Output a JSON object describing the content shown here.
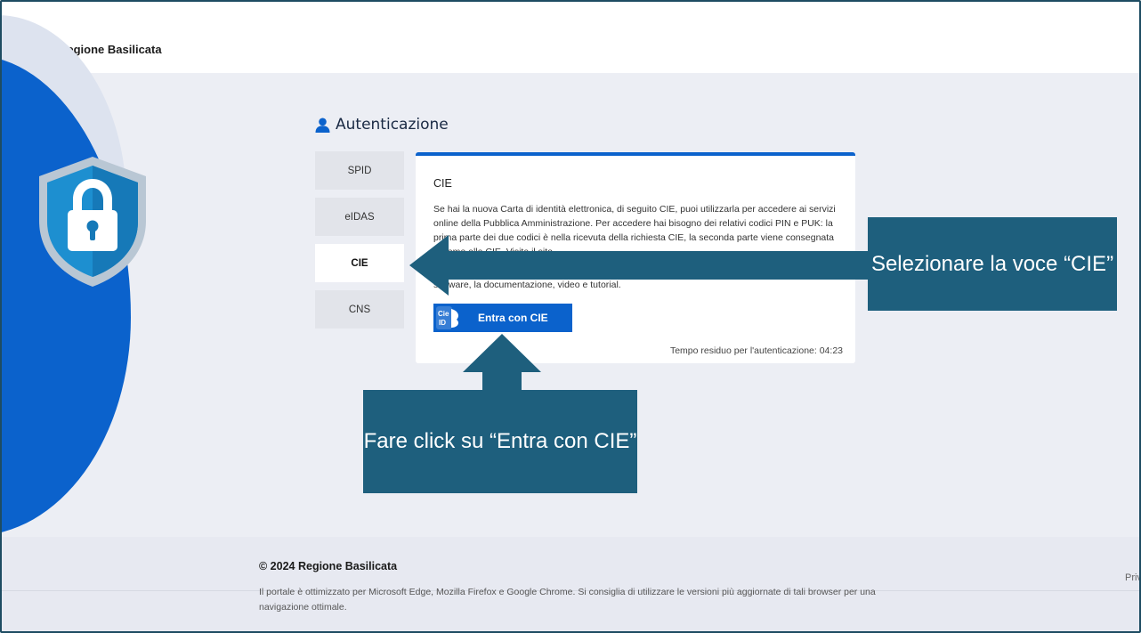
{
  "header": {
    "brand_name": "Regione Basilicata"
  },
  "auth": {
    "title": "Autenticazione",
    "tabs": [
      {
        "label": "SPID",
        "active": false
      },
      {
        "label": "eIDAS",
        "active": false
      },
      {
        "label": "CIE",
        "active": true
      },
      {
        "label": "CNS",
        "active": false
      }
    ],
    "panel": {
      "title": "CIE",
      "description": "Se hai la nuova Carta di identità elettronica, di seguito CIE, puoi utilizzarla per accedere ai servizi online della Pubblica Amministrazione. Per accedere hai bisogno dei relativi codici PIN e PUK: la prima parte dei due codici è nella ricevuta della richiesta CIE, la seconda parte viene consegnata insieme alla CIE. Visita il sito",
      "description_end": "software, la documentazione, video e tutorial.",
      "button_label": "Entra con CIE",
      "button_logo_text": "Cie ID",
      "timer_text": "Tempo residuo per l'autenticazione: 04:23"
    }
  },
  "callouts": {
    "right": "Selezionare la voce “CIE”",
    "bottom": "Fare click su “Entra con CIE”"
  },
  "footer": {
    "copyright": "© 2024 Regione Basilicata",
    "note": "Il portale è ottimizzato per Microsoft Edge, Mozilla Firefox e Google Chrome. Si consiglia di utilizzare le versioni più aggiornate di tali browser per una navigazione ottimale.",
    "privacy_partial": "Priva"
  },
  "colors": {
    "accent": "#0b62cc",
    "callout": "#1e5f7d",
    "shield_outer": "#a9b9c8",
    "shield_inner": "#1d8fd0"
  },
  "icons": [
    "regione-basilicata-logo-icon",
    "shield-lock-icon",
    "user-icon",
    "cie-id-logo-icon",
    "arrow-left-icon",
    "arrow-up-icon"
  ]
}
